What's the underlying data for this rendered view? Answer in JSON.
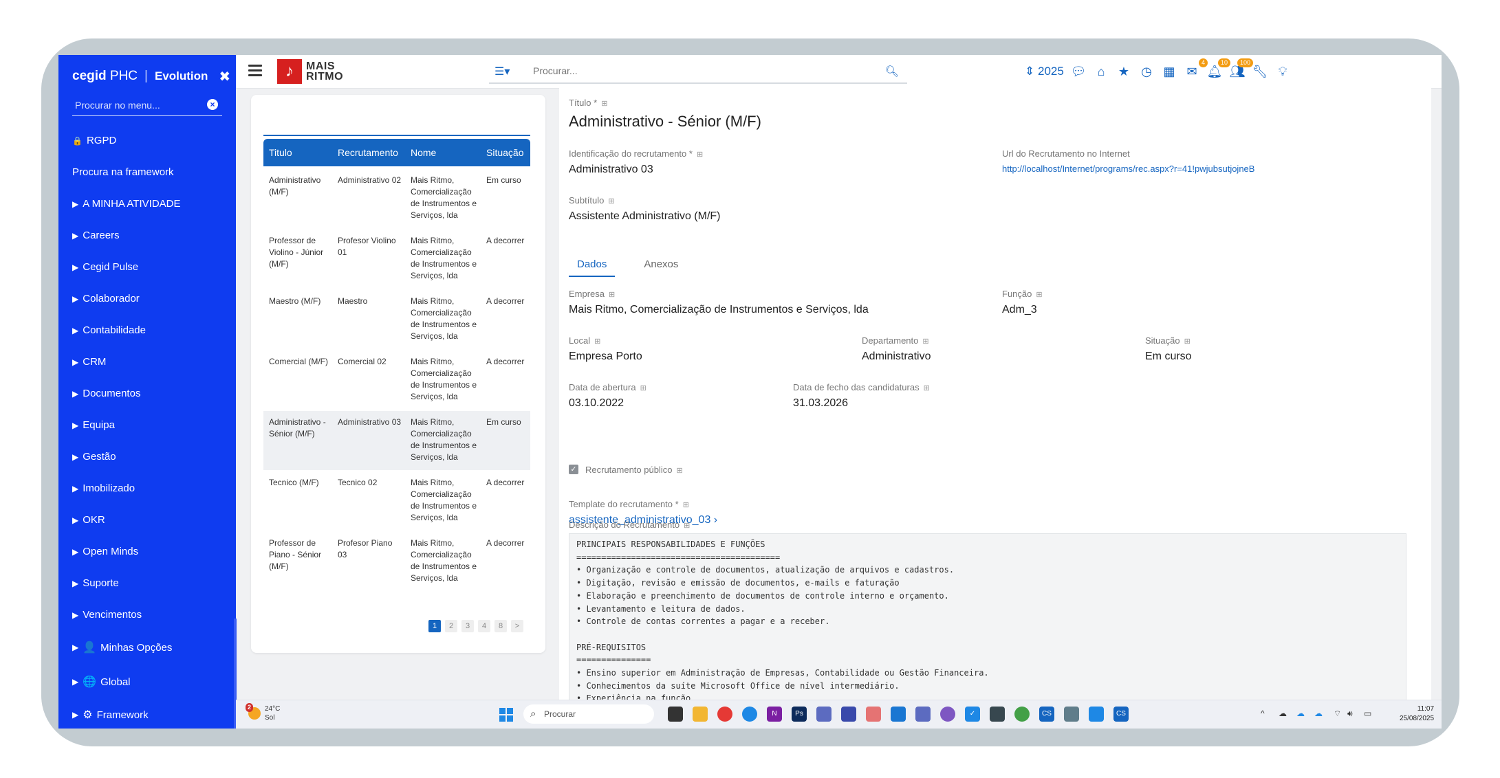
{
  "sidebar": {
    "brand_cegid": "cegid",
    "brand_phc": "PHC",
    "brand_separator": "|",
    "brand_product": "Evolution",
    "search_placeholder": "Procurar no menu...",
    "items": [
      {
        "label": "RGPD",
        "icon": "lock-icon"
      },
      {
        "label": "Procura na framework",
        "icon": ""
      },
      {
        "label": "A MINHA ATIVIDADE",
        "icon": "caret-right-icon"
      },
      {
        "label": "Careers",
        "icon": "caret-right-icon"
      },
      {
        "label": "Cegid Pulse",
        "icon": "caret-right-icon"
      },
      {
        "label": "Colaborador",
        "icon": "caret-right-icon"
      },
      {
        "label": "Contabilidade",
        "icon": "caret-right-icon"
      },
      {
        "label": "CRM",
        "icon": "caret-right-icon"
      },
      {
        "label": "Documentos",
        "icon": "caret-right-icon"
      },
      {
        "label": "Equipa",
        "icon": "caret-right-icon"
      },
      {
        "label": "Gestão",
        "icon": "caret-right-icon"
      },
      {
        "label": "Imobilizado",
        "icon": "caret-right-icon"
      },
      {
        "label": "OKR",
        "icon": "caret-right-icon"
      },
      {
        "label": "Open Minds",
        "icon": "caret-right-icon"
      },
      {
        "label": "Suporte",
        "icon": "caret-right-icon"
      },
      {
        "label": "Vencimentos",
        "icon": "caret-right-icon"
      },
      {
        "label": "Minhas Opções",
        "icon": "user-icon"
      },
      {
        "label": "Global",
        "icon": "globe-icon"
      },
      {
        "label": "Framework",
        "icon": "cogs-icon"
      }
    ]
  },
  "topbar": {
    "logo_line1": "MAIS",
    "logo_line2": "RITMO",
    "search_placeholder": "Procurar...",
    "year": "2025",
    "badges": {
      "mail": "4",
      "bell": "10",
      "users": "100"
    }
  },
  "list": {
    "headers": [
      "Titulo",
      "Recrutamento",
      "Nome",
      "Situação"
    ],
    "rows": [
      {
        "titulo": "Administrativo (M/F)",
        "recrutamento": "Administrativo 02",
        "nome": "Mais Ritmo, Comercialização de Instrumentos e Serviços, lda",
        "situacao": "Em curso"
      },
      {
        "titulo": "Professor de Violino - Júnior (M/F)",
        "recrutamento": "Profesor Violino 01",
        "nome": "Mais Ritmo, Comercialização de Instrumentos e Serviços, lda",
        "situacao": "A decorrer"
      },
      {
        "titulo": "Maestro (M/F)",
        "recrutamento": "Maestro",
        "nome": "Mais Ritmo, Comercialização de Instrumentos e Serviços, lda",
        "situacao": "A decorrer"
      },
      {
        "titulo": "Comercial (M/F)",
        "recrutamento": "Comercial 02",
        "nome": "Mais Ritmo, Comercialização de Instrumentos e Serviços, lda",
        "situacao": "A decorrer"
      },
      {
        "titulo": "Administrativo - Sénior (M/F)",
        "recrutamento": "Administrativo 03",
        "nome": "Mais Ritmo, Comercialização de Instrumentos e Serviços, lda",
        "situacao": "Em curso"
      },
      {
        "titulo": "Tecnico (M/F)",
        "recrutamento": "Tecnico 02",
        "nome": "Mais Ritmo, Comercialização de Instrumentos e Serviços, lda",
        "situacao": "A decorrer"
      },
      {
        "titulo": "Professor de Piano - Sénior (M/F)",
        "recrutamento": "Profesor Piano 03",
        "nome": "Mais Ritmo, Comercialização de Instrumentos e Serviços, lda",
        "situacao": "A decorrer"
      }
    ],
    "pages": [
      "1",
      "2",
      "3",
      "4",
      "8",
      ">"
    ]
  },
  "detail": {
    "titulo_label": "Título *",
    "titulo_value": "Administrativo - Sénior (M/F)",
    "ident_label": "Identificação do recrutamento *",
    "ident_value": "Administrativo 03",
    "url_label": "Url do Recrutamento no Internet",
    "url_value": "http://localhost/Internet/programs/rec.aspx?r=41!pwjubsutjojneB",
    "subtitulo_label": "Subtítulo",
    "subtitulo_value": "Assistente Administrativo (M/F)",
    "tabs": [
      "Dados",
      "Anexos"
    ],
    "empresa_label": "Empresa",
    "empresa_value": "Mais Ritmo, Comercialização de Instrumentos e Serviços, lda",
    "funcao_label": "Função",
    "funcao_value": "Adm_3",
    "local_label": "Local",
    "local_value": "Empresa Porto",
    "departamento_label": "Departamento",
    "departamento_value": "Administrativo",
    "situacao_label": "Situação",
    "situacao_value": "Em curso",
    "abertura_label": "Data de abertura",
    "abertura_value": "03.10.2022",
    "fecho_label": "Data de fecho das candidaturas",
    "fecho_value": "31.03.2026",
    "publico_label": "Recrutamento público",
    "template_label": "Template do recrutamento *",
    "template_value": "assistente_administrativo_03 ›",
    "descricao_label": "Descrição do Recrutamento",
    "descricao_text": "PRINCIPAIS RESPONSABILIDADES E FUNÇÕES\n=========================================\n• Organização e controle de documentos, atualização de arquivos e cadastros.\n• Digitação, revisão e emissão de documentos, e-mails e faturação\n• Elaboração e preenchimento de documentos de controle interno e orçamento.\n• Levantamento e leitura de dados.\n• Controle de contas correntes a pagar e a receber.\n\nPRÉ-REQUISITOS\n===============\n• Ensino superior em Administração de Empresas, Contabilidade ou Gestão Financeira.\n• Conhecimentos da suíte Microsoft Office de nível intermediário.\n• Experiência na função."
  },
  "taskbar": {
    "temp": "24°C",
    "weather": "Sol",
    "weather_badge": "2",
    "search": "Procurar",
    "time": "11:07",
    "date": "25/08/2025"
  }
}
